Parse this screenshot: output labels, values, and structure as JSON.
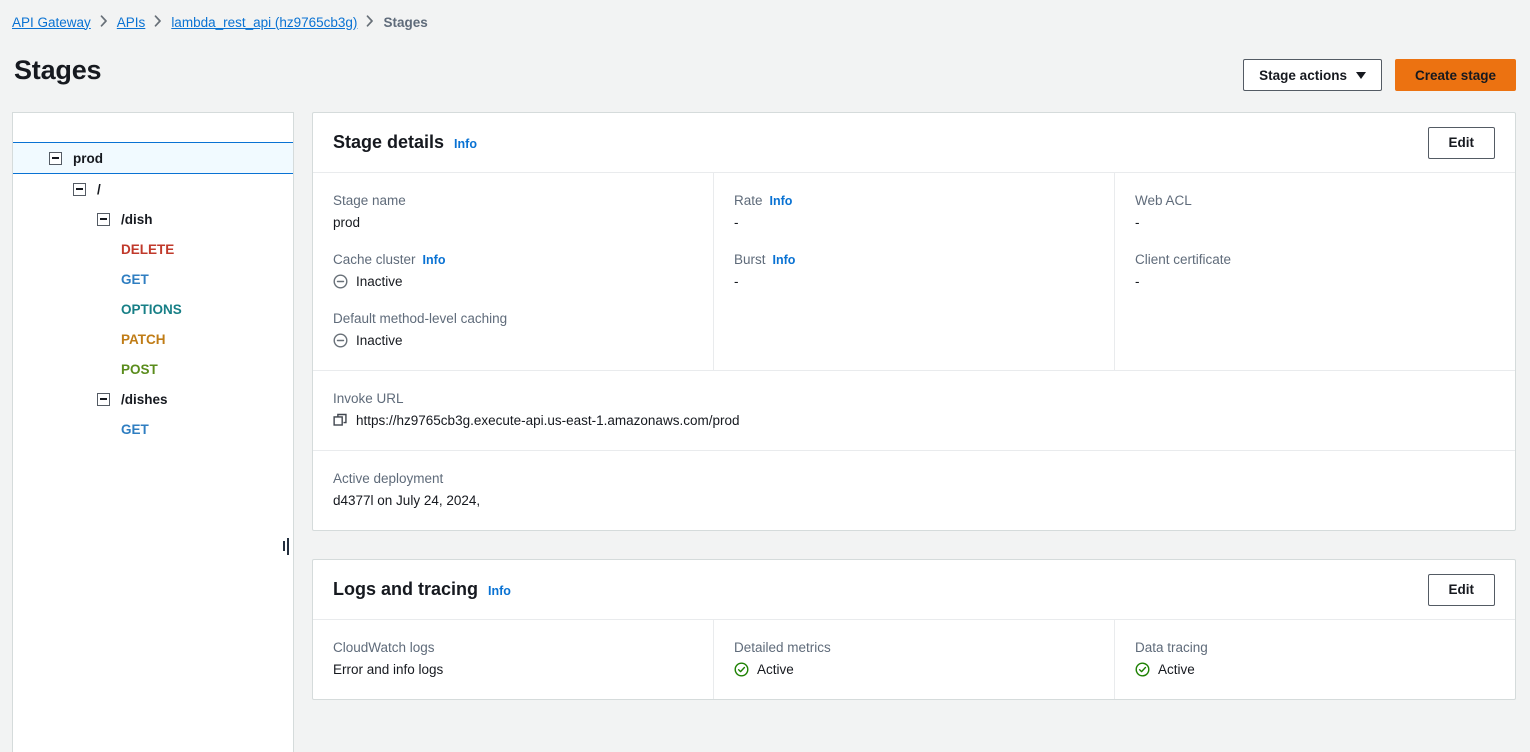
{
  "breadcrumb": {
    "items": [
      {
        "label": "API Gateway",
        "type": "link"
      },
      {
        "label": "APIs",
        "type": "link"
      },
      {
        "label": "lambda_rest_api (hz9765cb3g)",
        "type": "link"
      },
      {
        "label": "Stages",
        "type": "current"
      }
    ]
  },
  "page": {
    "title": "Stages"
  },
  "header_actions": {
    "stage_actions_label": "Stage actions",
    "create_stage_label": "Create stage",
    "dropdown_icon": "chevron-down-icon"
  },
  "sidebar": {
    "tree": [
      {
        "label": "prod",
        "indent": 0,
        "type": "stage",
        "expanded": true,
        "selected": true
      },
      {
        "label": "/",
        "indent": 1,
        "type": "resource",
        "expanded": true,
        "selected": false
      },
      {
        "label": "/dish",
        "indent": 2,
        "type": "resource",
        "expanded": true,
        "selected": false
      },
      {
        "label": "DELETE",
        "indent": 3,
        "type": "method",
        "method": "DELETE"
      },
      {
        "label": "GET",
        "indent": 3,
        "type": "method",
        "method": "GET"
      },
      {
        "label": "OPTIONS",
        "indent": 3,
        "type": "method",
        "method": "OPTIONS"
      },
      {
        "label": "PATCH",
        "indent": 3,
        "type": "method",
        "method": "PATCH"
      },
      {
        "label": "POST",
        "indent": 3,
        "type": "method",
        "method": "POST"
      },
      {
        "label": "/dishes",
        "indent": 2,
        "type": "resource",
        "expanded": true,
        "selected": false
      },
      {
        "label": "GET",
        "indent": 3,
        "type": "method",
        "method": "GET"
      }
    ],
    "resize_handle": "sidebar-resize-handle"
  },
  "stage_details": {
    "title": "Stage details",
    "info_label": "Info",
    "edit_label": "Edit",
    "col1": [
      {
        "label": "Stage name",
        "info": false,
        "value": "prod",
        "status": "none"
      },
      {
        "label": "Cache cluster",
        "info": true,
        "info_label": "Info",
        "value": "Inactive",
        "status": "inactive"
      },
      {
        "label": "Default method-level caching",
        "info": false,
        "value": "Inactive",
        "status": "inactive"
      }
    ],
    "col2": [
      {
        "label": "Rate",
        "info": true,
        "info_label": "Info",
        "value": "-",
        "status": "none"
      },
      {
        "label": "Burst",
        "info": true,
        "info_label": "Info",
        "value": "-",
        "status": "none"
      }
    ],
    "col3": [
      {
        "label": "Web ACL",
        "info": false,
        "value": "-",
        "status": "none"
      },
      {
        "label": "Client certificate",
        "info": false,
        "value": "-",
        "status": "none"
      }
    ],
    "invoke_url": {
      "label": "Invoke URL",
      "value": "https://hz9765cb3g.execute-api.us-east-1.amazonaws.com/prod",
      "copy_icon": "copy-icon"
    },
    "active_deployment": {
      "label": "Active deployment",
      "value": "d4377l on July 24, 2024,"
    }
  },
  "logs_and_tracing": {
    "title": "Logs and tracing",
    "info_label": "Info",
    "edit_label": "Edit",
    "fields": [
      {
        "label": "CloudWatch logs",
        "value": "Error and info logs",
        "status": "none"
      },
      {
        "label": "Detailed metrics",
        "value": "Active",
        "status": "active"
      },
      {
        "label": "Data tracing",
        "value": "Active",
        "status": "active"
      }
    ]
  },
  "colors": {
    "accent_link": "#0972d3",
    "primary_button": "#ec7211",
    "active_green": "#1d8102",
    "inactive_gray": "#687078",
    "method_delete": "#c0392b",
    "method_get": "#2f7ec1",
    "method_options": "#177f86",
    "method_patch": "#c07c16",
    "method_post": "#5a8c1c"
  }
}
